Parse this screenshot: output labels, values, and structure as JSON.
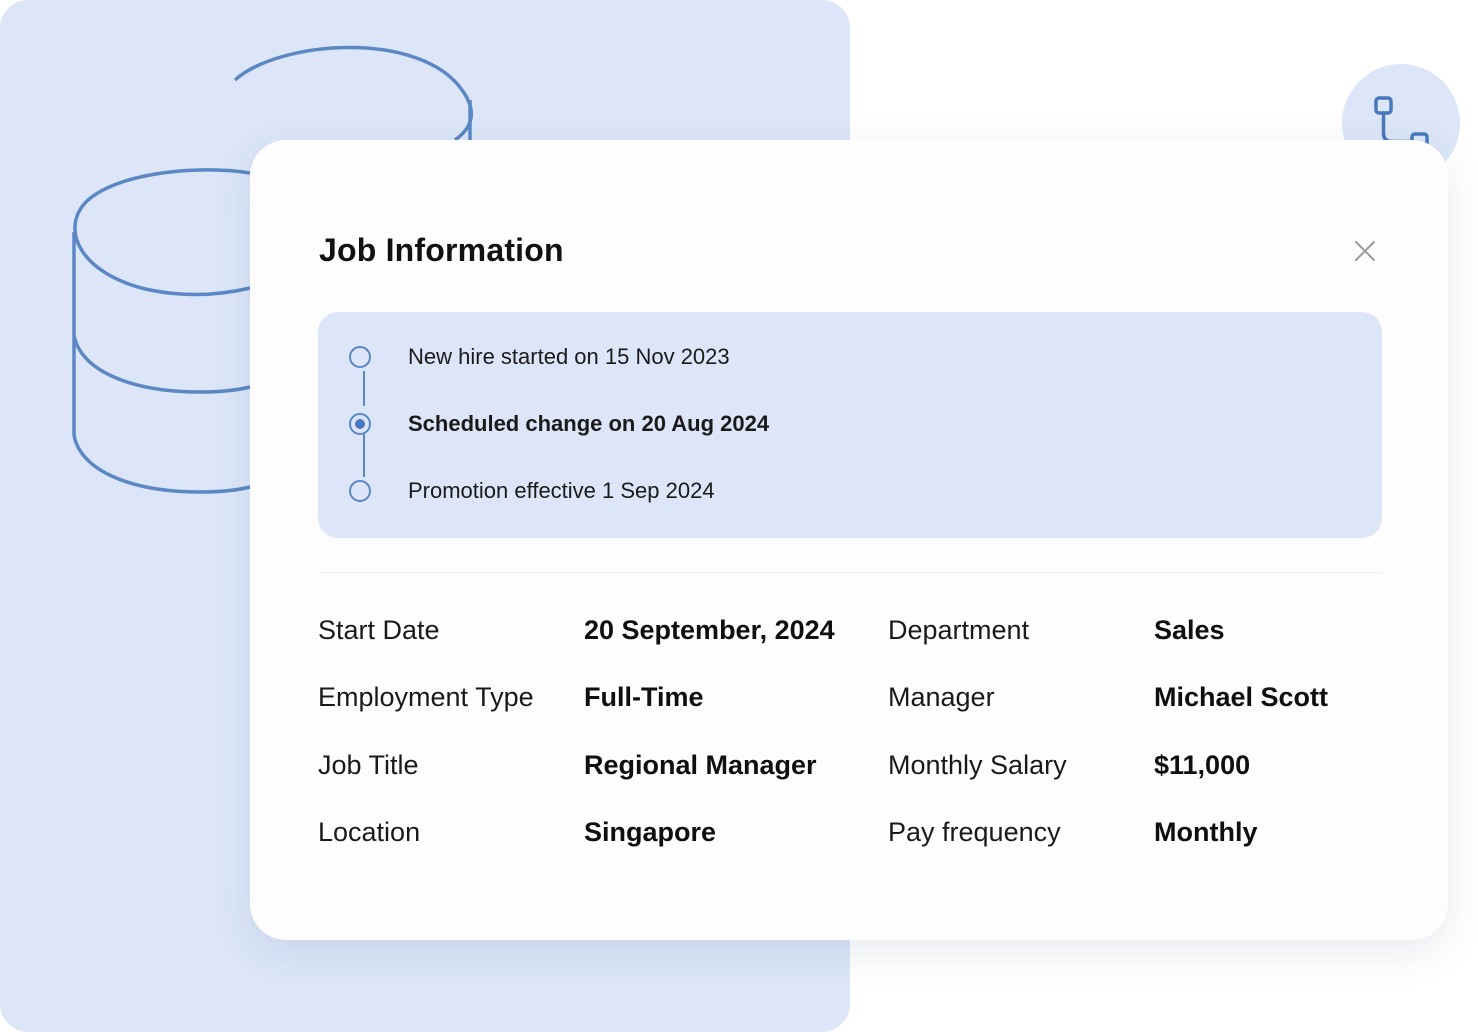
{
  "colors": {
    "accent": "#5b87c5",
    "panel": "#dce6f8",
    "card": "#fdfdfd",
    "text": "#111111"
  },
  "icons": {
    "database": "database-icon",
    "flow": "flow-connector-icon",
    "close": "close-icon"
  },
  "card": {
    "title": "Job Information"
  },
  "timeline": [
    {
      "text": "New hire started on 15 Nov 2023",
      "active": false
    },
    {
      "text": "Scheduled change on 20 Aug 2024",
      "active": true
    },
    {
      "text": "Promotion effective 1 Sep 2024",
      "active": false
    }
  ],
  "details": [
    {
      "label": "Start Date",
      "value": "20 September, 2024",
      "label2": "Department",
      "value2": "Sales"
    },
    {
      "label": "Employment Type",
      "value": "Full-Time",
      "label2": "Manager",
      "value2": "Michael Scott"
    },
    {
      "label": "Job Title",
      "value": "Regional Manager",
      "label2": "Monthly Salary",
      "value2": "$11,000"
    },
    {
      "label": "Location",
      "value": "Singapore",
      "label2": "Pay frequency",
      "value2": "Monthly"
    }
  ]
}
